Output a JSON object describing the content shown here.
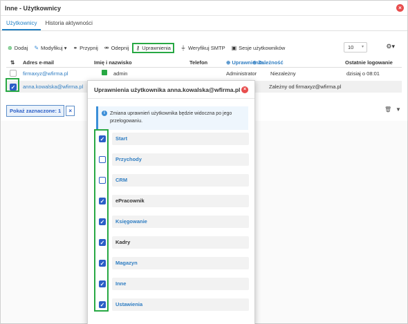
{
  "window": {
    "title": "Inne - Użytkownicy"
  },
  "tabs": [
    {
      "label": "Użytkownicy"
    },
    {
      "label": "Historia aktywności"
    }
  ],
  "toolbar": {
    "add": "Dodaj",
    "modify": "Modyfikuj",
    "assign": "Przypnij",
    "unassign": "Odepnij",
    "permissions": "Uprawnienia",
    "verify_smtp": "Weryfikuj SMTP",
    "sessions": "Sesje użytkowników",
    "page_size": "10"
  },
  "table": {
    "headers": {
      "email": "Adres e-mail",
      "name": "Imię i nazwisko",
      "phone": "Telefon",
      "permissions": "Uprawnienia...",
      "dependency": "Zależność",
      "last_login": "Ostatnie logowanie"
    },
    "rows": [
      {
        "email": "firmaxyz@wfirma.pl",
        "name": "admin",
        "phone": "",
        "permissions": "Administrator",
        "dependency": "Niezależny",
        "last_login": "dzisiaj o 08:01"
      },
      {
        "email": "anna.kowalska@wfirma.pl",
        "name": "",
        "phone": "",
        "permissions": "",
        "dependency": "Zależny od firmaxyz@wfirma.pl",
        "last_login": ""
      }
    ]
  },
  "selection": {
    "label": "Pokaż zaznaczone: 1"
  },
  "modal": {
    "title": "Uprawnienia użytkownika anna.kowalska@wfirma.pl",
    "info": "Zmiana uprawnień użytkownika będzie widoczna po jego przelogowaniu.",
    "permissions": [
      {
        "label": "Start",
        "checked": true
      },
      {
        "label": "Przychody",
        "checked": false
      },
      {
        "label": "CRM",
        "checked": false
      },
      {
        "label": "ePracownik",
        "checked": true
      },
      {
        "label": "Księgowanie",
        "checked": true
      },
      {
        "label": "Kadry",
        "checked": true
      },
      {
        "label": "Magazyn",
        "checked": true
      },
      {
        "label": "Inne",
        "checked": true
      },
      {
        "label": "Ustawienia",
        "checked": true
      }
    ]
  },
  "colors": {
    "accent": "#1f7fc4",
    "highlight": "#27a843",
    "checkbox": "#2b5fc7",
    "close": "#e84d4d"
  }
}
